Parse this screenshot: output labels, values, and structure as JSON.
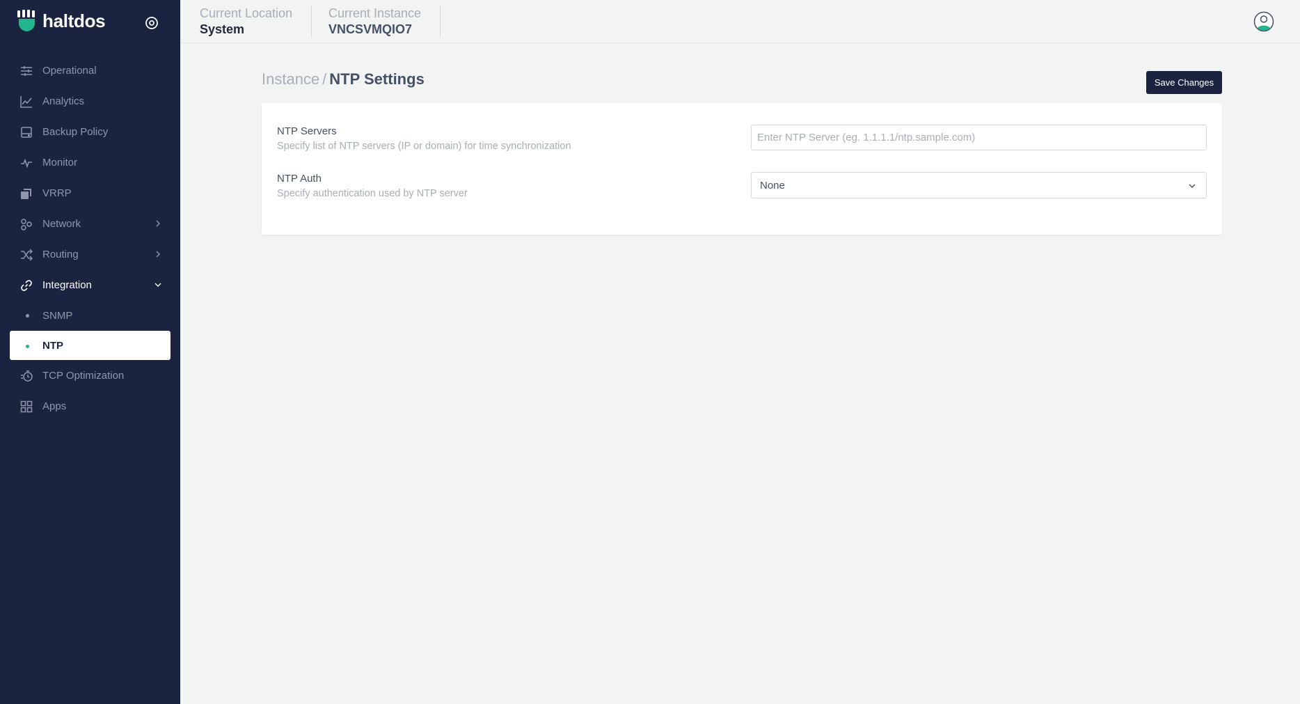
{
  "brand": {
    "name": "haltdos",
    "accent": "#22b58e"
  },
  "sidebar": {
    "settings_icon": "settings-ring-icon",
    "items": [
      {
        "label": "Operational",
        "icon": "sliders-icon"
      },
      {
        "label": "Analytics",
        "icon": "line-chart-icon"
      },
      {
        "label": "Backup Policy",
        "icon": "hard-drive-icon"
      },
      {
        "label": "Monitor",
        "icon": "pulse-icon"
      },
      {
        "label": "VRRP",
        "icon": "copy-icon"
      },
      {
        "label": "Network",
        "icon": "network-icon",
        "chevron": "right"
      },
      {
        "label": "Routing",
        "icon": "shuffle-icon",
        "chevron": "right"
      },
      {
        "label": "Integration",
        "icon": "link-icon",
        "chevron": "down",
        "expanded": true
      },
      {
        "label": "SNMP",
        "sub": true
      },
      {
        "label": "NTP",
        "sub": true,
        "active": true
      },
      {
        "label": "TCP Optimization",
        "icon": "stopwatch-icon"
      },
      {
        "label": "Apps",
        "icon": "grid-icon"
      }
    ]
  },
  "topbar": {
    "location_label": "Current Location",
    "location_value": "System",
    "instance_label": "Current Instance",
    "instance_value": "VNCSVMQIO7"
  },
  "main": {
    "breadcrumb_parent": "Instance",
    "breadcrumb_sep": "/",
    "title": "NTP Settings",
    "save_label": "Save Changes",
    "fields": {
      "ntp_servers": {
        "label": "NTP Servers",
        "description": "Specify list of NTP servers (IP or domain) for time synchronization",
        "placeholder": "Enter NTP Server (eg. 1.1.1.1/ntp.sample.com)",
        "value": ""
      },
      "ntp_auth": {
        "label": "NTP Auth",
        "description": "Specify authentication used by NTP server",
        "value": "None"
      }
    }
  }
}
